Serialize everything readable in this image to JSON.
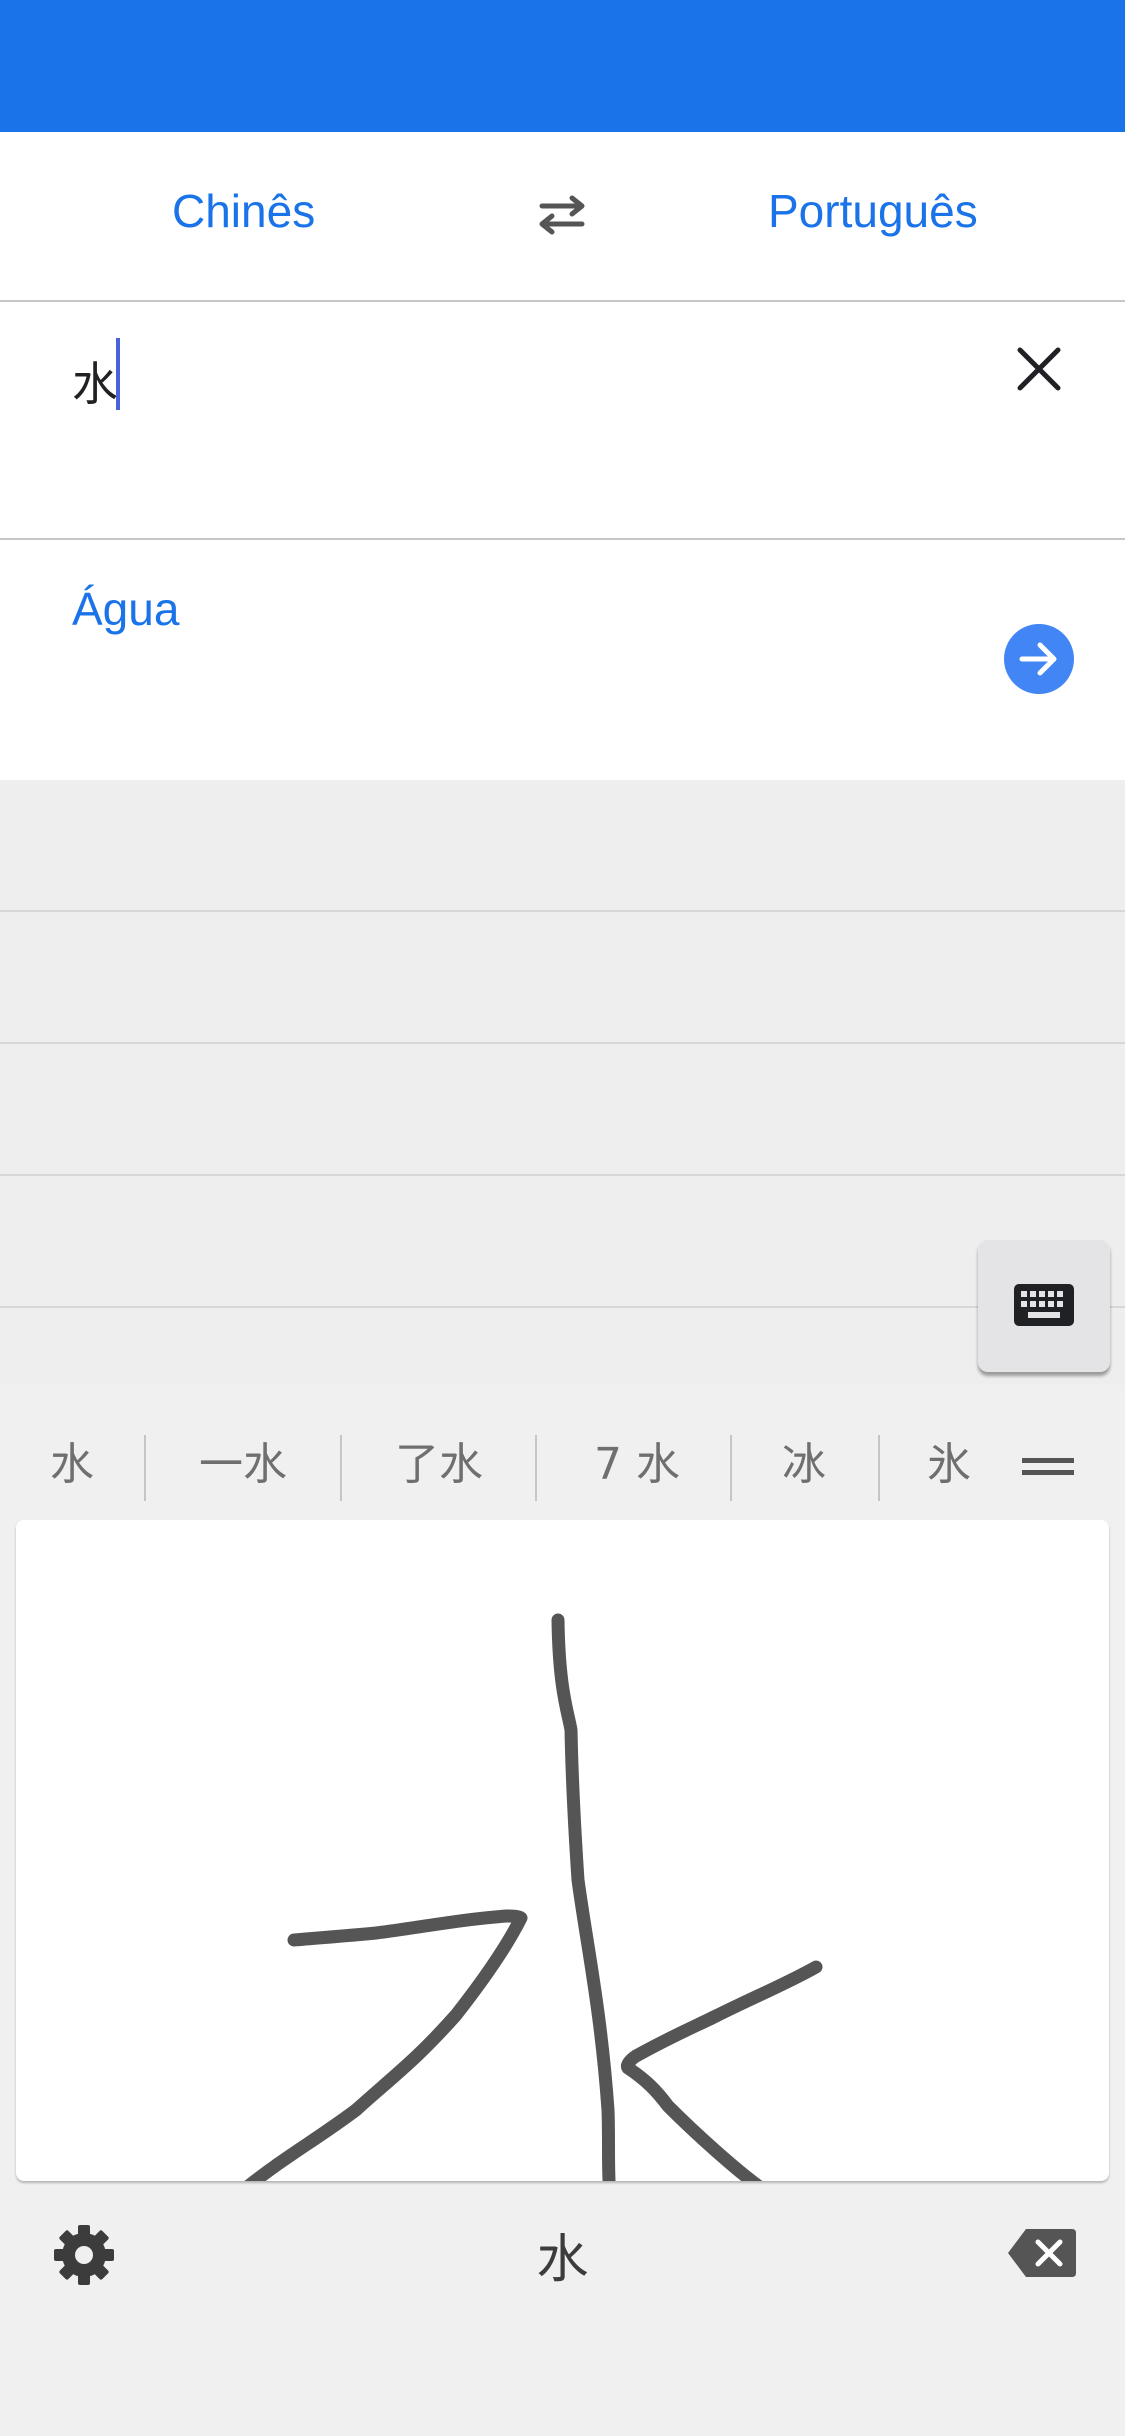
{
  "languages": {
    "source": "Chinês",
    "target": "Português"
  },
  "input": {
    "text": "水"
  },
  "result": {
    "text": "Água"
  },
  "candidates": [
    "水",
    "一水",
    "了水",
    "7 水",
    "冰",
    "氷"
  ],
  "bottom_bar": {
    "current_char": "水"
  },
  "colors": {
    "brand": "#1a73e8",
    "accent": "#4285f4",
    "ink": "#555555"
  },
  "icons": [
    "swap-languages-icon",
    "close-icon",
    "arrow-right-icon",
    "keyboard-icon",
    "more-candidates-icon",
    "gear-icon",
    "backspace-icon"
  ]
}
